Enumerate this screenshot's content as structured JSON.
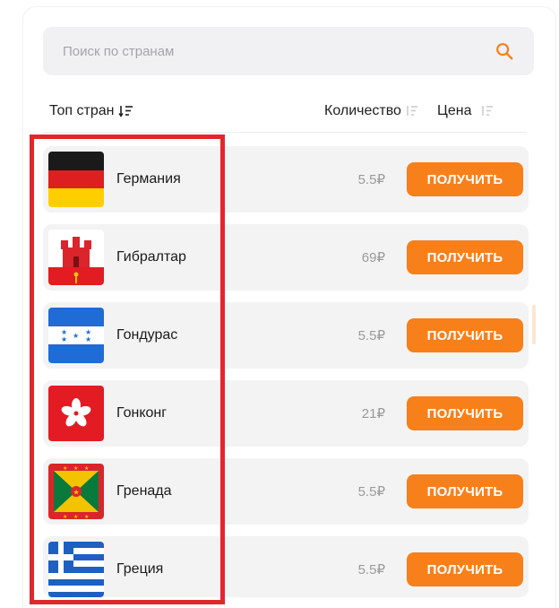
{
  "search": {
    "placeholder": "Поиск по странам",
    "icon": "search-icon"
  },
  "header": {
    "top_label": "Топ стран",
    "quantity_label": "Количество",
    "price_label": "Цена"
  },
  "colors": {
    "accent": "#f7801b",
    "highlight": "#e3262e",
    "row_bg": "#f3f3f4"
  },
  "countries": [
    {
      "name": "Германия",
      "price": "5.5₽",
      "button": "ПОЛУЧИТЬ",
      "flag": "germany-flag"
    },
    {
      "name": "Гибралтар",
      "price": "69₽",
      "button": "ПОЛУЧИТЬ",
      "flag": "gibraltar-flag"
    },
    {
      "name": "Гондурас",
      "price": "5.5₽",
      "button": "ПОЛУЧИТЬ",
      "flag": "honduras-flag"
    },
    {
      "name": "Гонконг",
      "price": "21₽",
      "button": "ПОЛУЧИТЬ",
      "flag": "hong-kong-flag"
    },
    {
      "name": "Гренада",
      "price": "5.5₽",
      "button": "ПОЛУЧИТЬ",
      "flag": "grenada-flag"
    },
    {
      "name": "Греция",
      "price": "5.5₽",
      "button": "ПОЛУЧИТЬ",
      "flag": "greece-flag"
    }
  ]
}
